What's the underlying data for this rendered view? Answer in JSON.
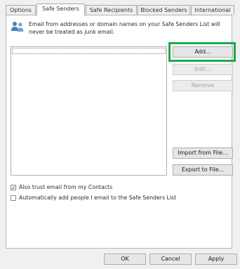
{
  "tabs": [
    "Options",
    "Safe Senders",
    "Safe Recipients",
    "Blocked Senders",
    "International"
  ],
  "active_tab": "Safe Senders",
  "info": {
    "line1": "Email from addresses or domain names on your Safe Senders List will",
    "line2": "never be treated as junk email."
  },
  "buttons": {
    "add": "Add...",
    "edit": "Edit...",
    "remove": "Remove",
    "import": "Import from File...",
    "export": "Export to File..."
  },
  "checkboxes": {
    "trust_contacts": {
      "label": "Also trust email from my Contacts",
      "checked": true
    },
    "auto_add": {
      "label": "Automatically add people I email to the Safe Senders List",
      "checked": false
    }
  },
  "footer": {
    "ok": "OK",
    "cancel": "Cancel",
    "apply": "Apply"
  },
  "colors": {
    "highlight": "#1faa4a"
  }
}
